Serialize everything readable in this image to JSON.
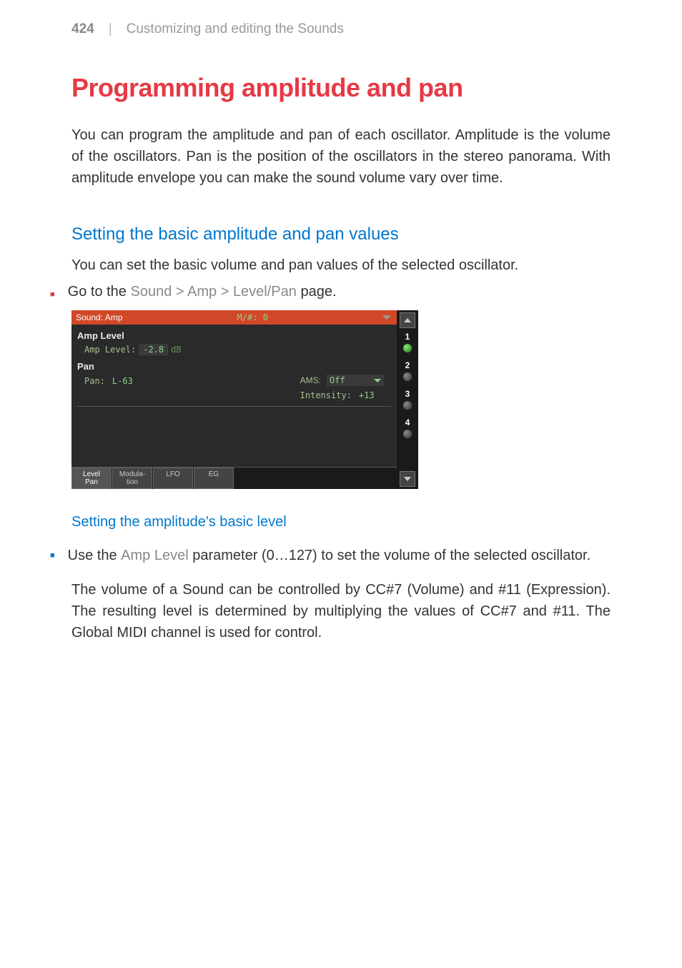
{
  "header": {
    "page_number": "424",
    "separator": "|",
    "chapter": "Customizing and editing the Sounds"
  },
  "title": "Programming amplitude and pan",
  "intro": "You can program the amplitude and pan of each oscillator. Amplitude is the volume of the oscillators. Pan is the position of the oscillators in the stereo panorama. With amplitude envelope you can make the sound volume vary over time.",
  "section1": {
    "heading": "Setting the basic amplitude and pan values",
    "body": "You can set the basic volume and pan values of the selected oscillator.",
    "bullet_prefix": "Go to the ",
    "menu_path": "Sound > Amp > Level/Pan",
    "bullet_suffix": " page."
  },
  "ui": {
    "titlebar": {
      "left": "Sound: Amp",
      "center": "M/#: 0"
    },
    "amp": {
      "group": "Amp Level",
      "label": "Amp Level:",
      "value": "-2.8",
      "unit": "dB"
    },
    "pan": {
      "group": "Pan",
      "label": "Pan:",
      "value": "L-63",
      "ams_label": "AMS:",
      "ams_value": "Off",
      "intensity_label": "Intensity:",
      "intensity_value": "+13"
    },
    "tabs": [
      "Level\nPan",
      "Modula-\ntion",
      "LFO",
      "EG"
    ],
    "osc": [
      "1",
      "2",
      "3",
      "4"
    ]
  },
  "section2": {
    "heading": "Setting the amplitude's basic level",
    "bullet_prefix": "Use the ",
    "param": "Amp Level",
    "bullet_suffix": " parameter (0…127) to set the volume of the selected oscillator.",
    "para": "The volume of a Sound can be controlled by CC#7 (Volume) and #11 (Expression). The resulting level is determined by multiplying the values of CC#7 and #11. The Global MIDI channel is used for control."
  }
}
